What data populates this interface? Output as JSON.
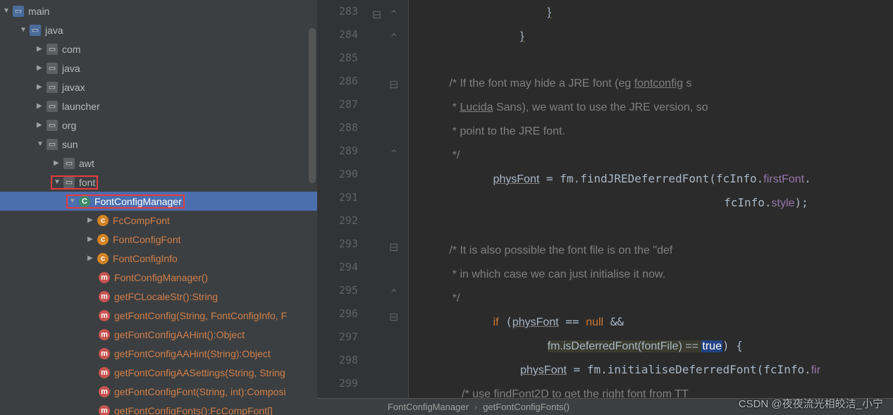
{
  "tree": {
    "main": "main",
    "java": "java",
    "com": "com",
    "java2": "java",
    "javax": "javax",
    "launcher": "launcher",
    "org": "org",
    "sun": "sun",
    "awt": "awt",
    "font": "font",
    "inner": {
      "fontconfigmanager": "FontConfigManager",
      "fccompfont": "FcCompFont",
      "fontconfigfont": "FontConfigFont",
      "fontconfiginfo": "FontConfigInfo"
    },
    "methods": {
      "ctor": "FontConfigManager()",
      "getFCLocaleStr": "getFCLocaleStr():String",
      "getFontConfig": "getFontConfig(String, FontConfigInfo, F",
      "getFontConfigAAHint1": "getFontConfigAAHint():Object",
      "getFontConfigAAHint2": "getFontConfigAAHint(String):Object",
      "getFontConfigAASettings": "getFontConfigAASettings(String, String",
      "getFontConfigFont": "getFontConfigFont(String, int):Composi",
      "getFontConfigFonts": "getFontConfigFonts():FcCompFont[]"
    }
  },
  "code": {
    "line_start": 283,
    "lines": [
      "                    }",
      "                }",
      "",
      "            /* If the font may hide a JRE font (eg fontconfig s",
      "             * Lucida Sans), we want to use the JRE version, so",
      "             * point to the JRE font.",
      "             */",
      "            physFont = fm.findJREDeferredFont(fcInfo.firstFont.",
      "                                              fcInfo.style);",
      "",
      "            /* It is also possible the font file is on the \"def",
      "             * in which case we can just initialise it now.",
      "             */",
      "            if (physFont == null &&",
      "                    fm.isDeferredFont(fontFile) == true) {",
      "                physFont = fm.initialiseDeferredFont(fcInfo.fir",
      "                /* use findFont2D to get the right font from TT"
    ]
  },
  "breadcrumb": {
    "a": "FontConfigManager",
    "b": "getFontConfigFonts()"
  },
  "watermark": "CSDN @夜夜流光相皎洁_小宁"
}
